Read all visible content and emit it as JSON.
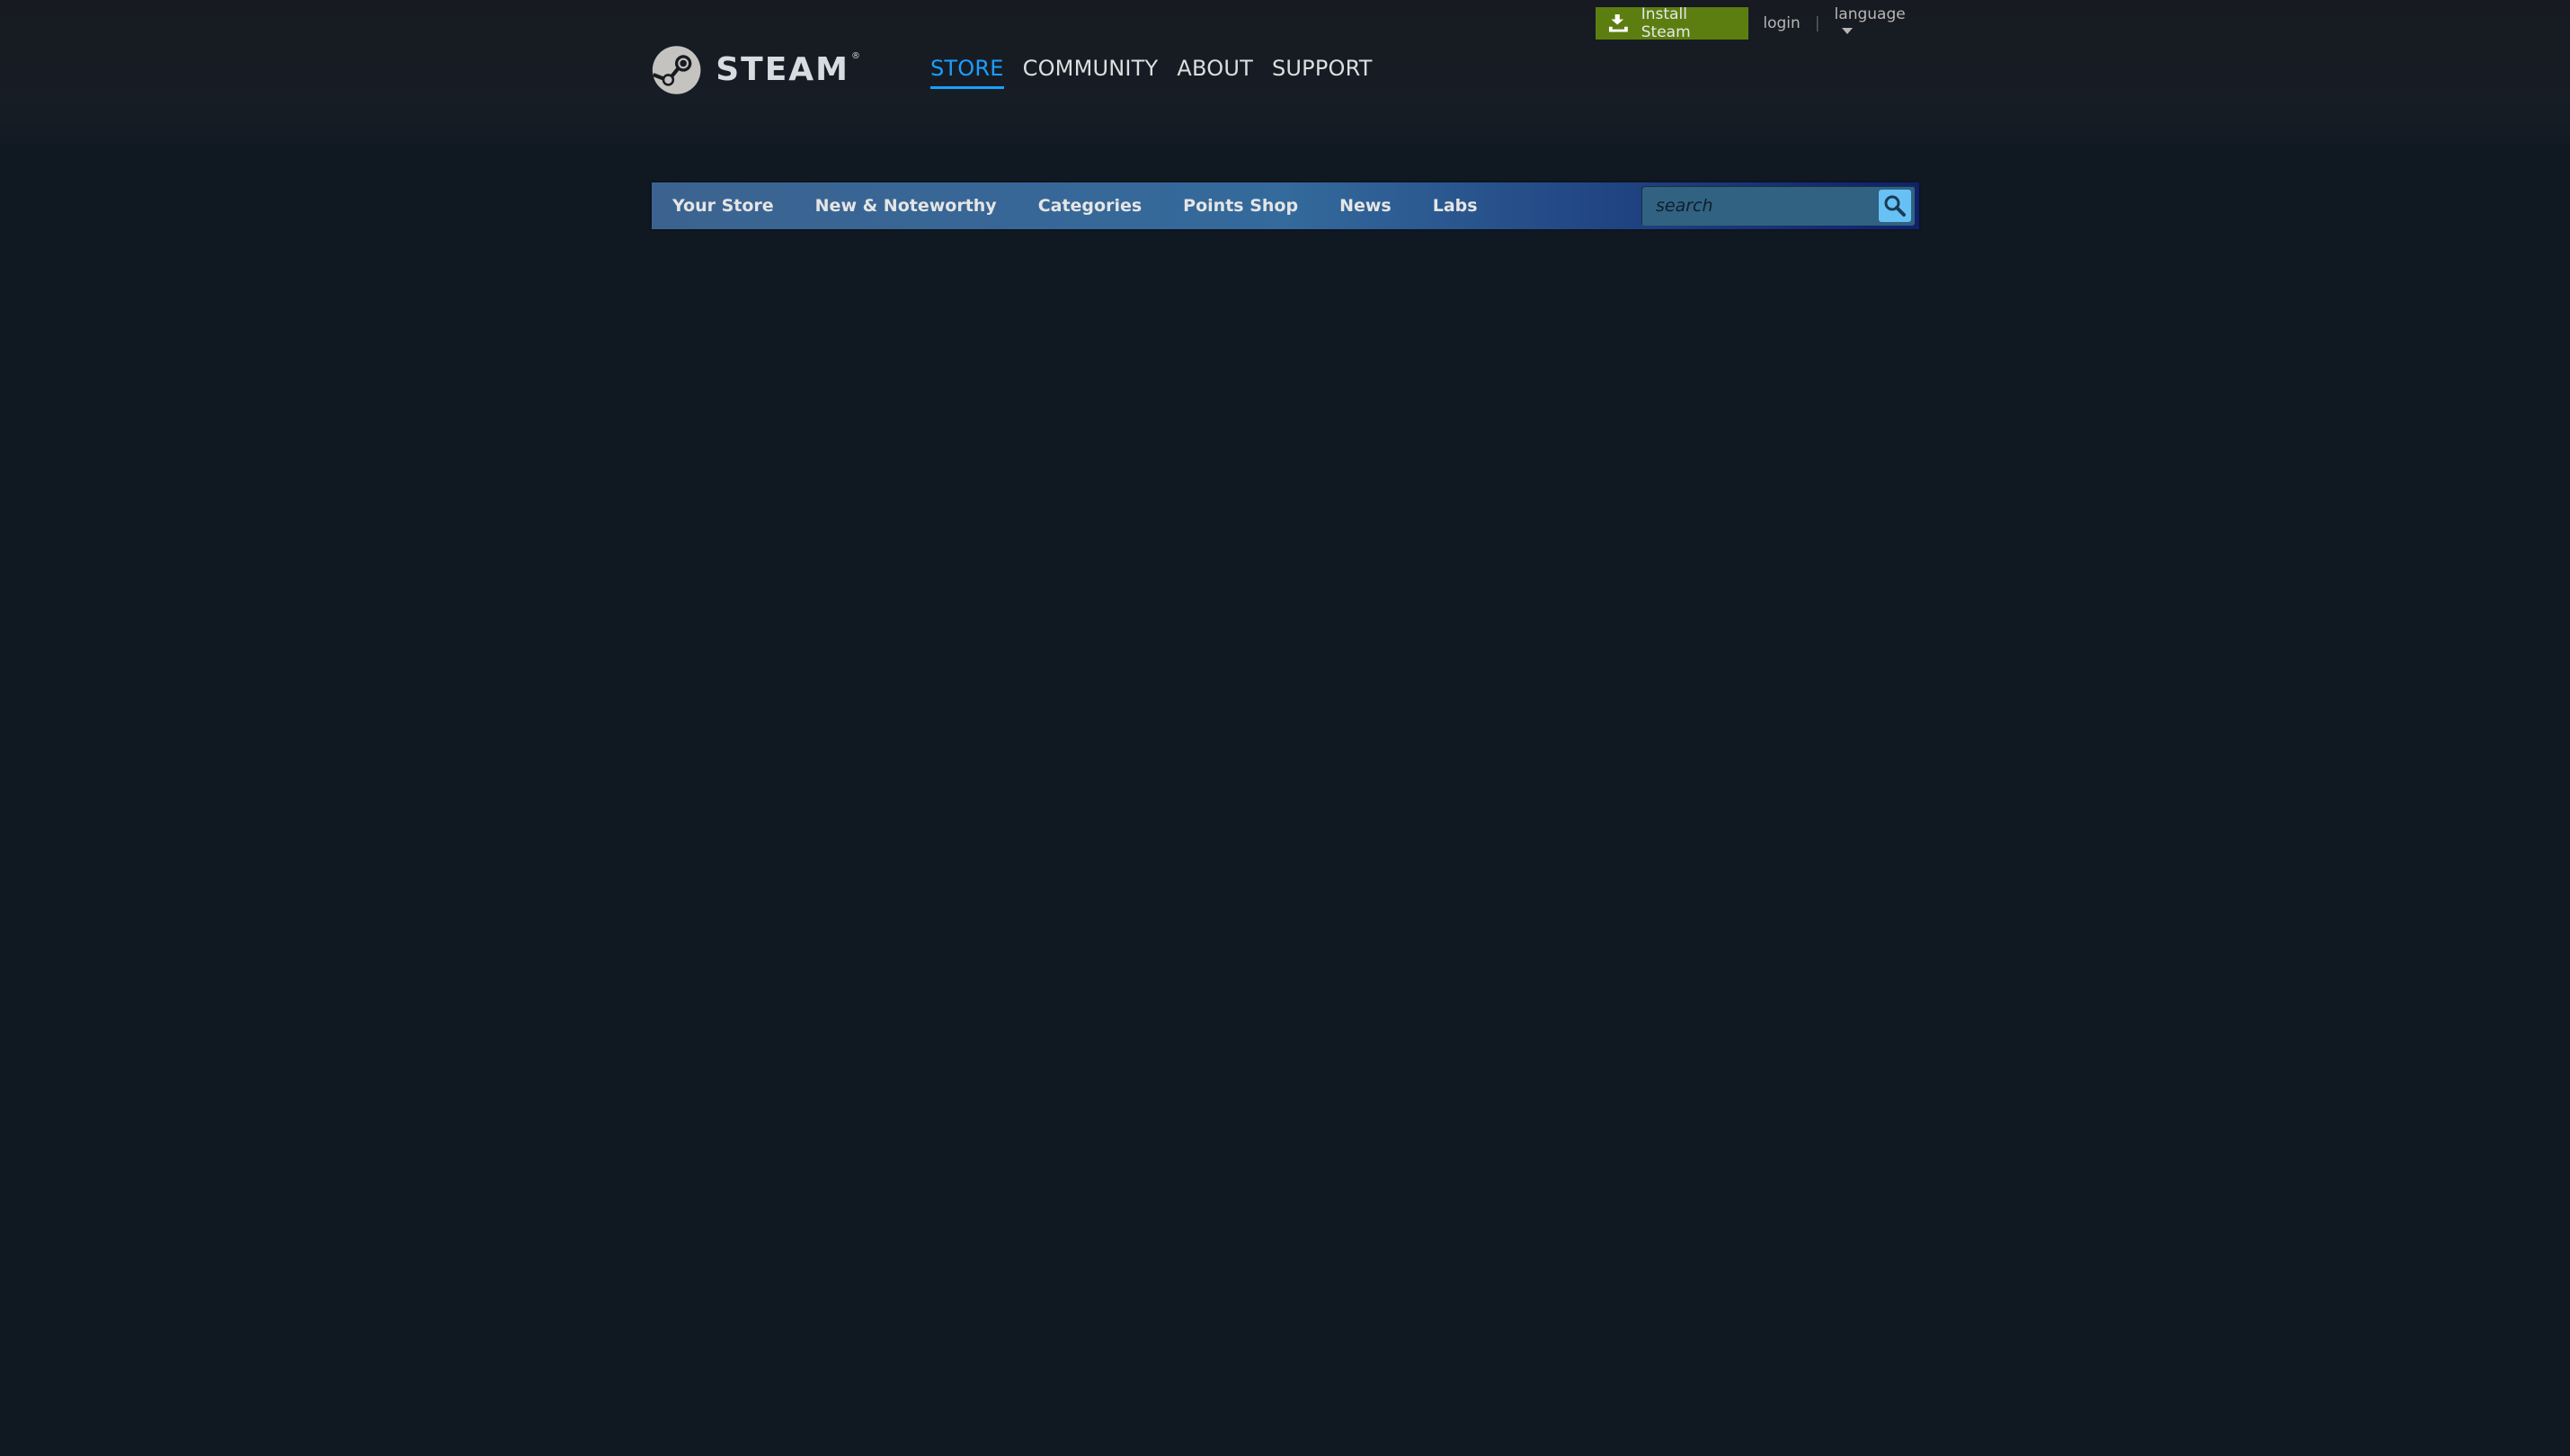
{
  "logo": {
    "text": "STEAM",
    "reg": "®"
  },
  "supernav": {
    "items": [
      {
        "label": "STORE",
        "active": true
      },
      {
        "label": "COMMUNITY",
        "active": false
      },
      {
        "label": "ABOUT",
        "active": false
      },
      {
        "label": "SUPPORT",
        "active": false
      }
    ]
  },
  "global_actions": {
    "install_label": "Install Steam",
    "login_label": "login",
    "separator": "|",
    "language_label": "language"
  },
  "store_nav": {
    "tabs": [
      "Your Store",
      "New & Noteworthy",
      "Categories",
      "Points Shop",
      "News",
      "Labs"
    ],
    "search_placeholder": "search"
  },
  "colors": {
    "background": "#101822",
    "accent_blue": "#1a9fff",
    "install_green": "#5c7e10",
    "search_button": "#67c1f5"
  },
  "icons": {
    "logo": "steam-logo-icon",
    "install": "download-icon",
    "language": "chevron-down-icon",
    "search": "search-icon"
  }
}
